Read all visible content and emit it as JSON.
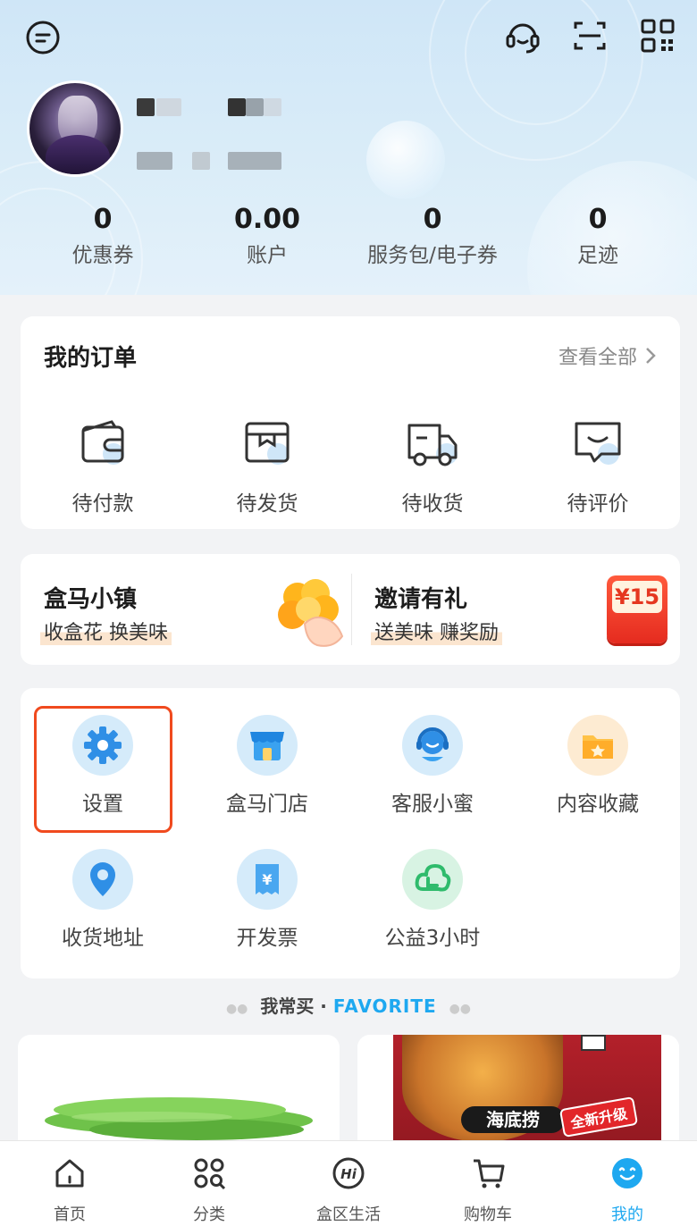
{
  "header": {
    "stats": [
      {
        "value": "0",
        "label": "优惠券"
      },
      {
        "value": "0.00",
        "label": "账户"
      },
      {
        "value": "0",
        "label": "服务包/电子券"
      },
      {
        "value": "0",
        "label": "足迹"
      }
    ]
  },
  "orders": {
    "title": "我的订单",
    "view_all": "查看全部",
    "items": [
      {
        "label": "待付款",
        "icon": "wallet-icon"
      },
      {
        "label": "待发货",
        "icon": "package-icon"
      },
      {
        "label": "待收货",
        "icon": "truck-icon"
      },
      {
        "label": "待评价",
        "icon": "review-icon"
      }
    ]
  },
  "promos": [
    {
      "title": "盒马小镇",
      "subtitle": "收盒花 换美味"
    },
    {
      "title": "邀请有礼",
      "subtitle": "送美味 赚奖励",
      "badge": "¥15"
    }
  ],
  "services": [
    {
      "label": "设置",
      "icon": "gear-icon"
    },
    {
      "label": "盒马门店",
      "icon": "store-icon"
    },
    {
      "label": "客服小蜜",
      "icon": "customer-service-icon"
    },
    {
      "label": "内容收藏",
      "icon": "folder-star-icon"
    },
    {
      "label": "收货地址",
      "icon": "location-pin-icon"
    },
    {
      "label": "开发票",
      "icon": "invoice-icon"
    },
    {
      "label": "公益3小时",
      "icon": "charity-icon"
    }
  ],
  "favorite": {
    "zh": "我常买 · ",
    "en": "FAVORITE"
  },
  "products": [
    {
      "brand": ""
    },
    {
      "brand": "海底捞",
      "tag": "全新升级"
    }
  ],
  "tabbar": [
    {
      "label": "首页",
      "icon": "home-icon"
    },
    {
      "label": "分类",
      "icon": "category-icon"
    },
    {
      "label": "盒区生活",
      "icon": "hi-icon"
    },
    {
      "label": "购物车",
      "icon": "cart-icon"
    },
    {
      "label": "我的",
      "icon": "profile-icon",
      "active": true
    }
  ],
  "colors": {
    "accent": "#1ea8f0",
    "highlight_box": "#f04a1e",
    "header_bg": "#d3e9f8"
  }
}
